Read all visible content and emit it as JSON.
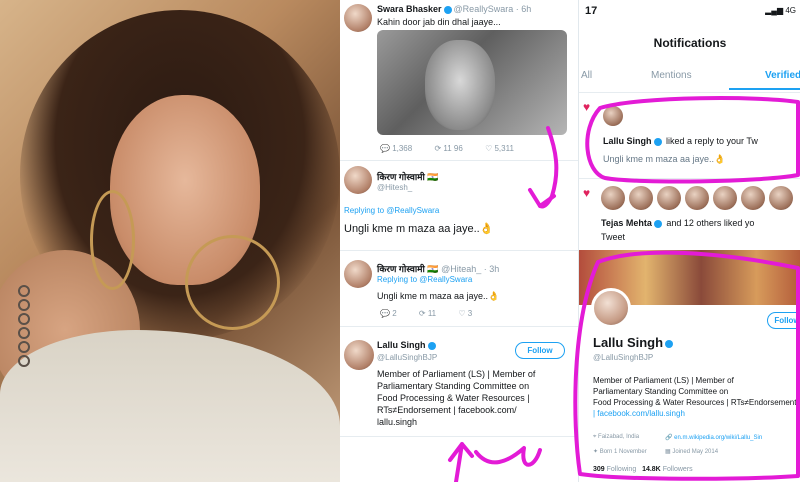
{
  "colors": {
    "annotation": "#e31bd6",
    "twitter_blue": "#1da1f2",
    "heart": "#e0245e"
  },
  "middle": {
    "tweet1": {
      "name": "Swara Bhasker",
      "handle": "@ReallySwara · 6h",
      "text": "Kahin door jab din dhal jaaye...",
      "actions": [
        "1,368",
        "11 96",
        "5,311"
      ]
    },
    "reply1": {
      "name": "किरण गोस्वामी 🇮🇳",
      "handle": "@Hitesh_",
      "replying_to": "Replying to @ReallySwara",
      "text": "Ungli kme m maza aa jaye..👌"
    },
    "reply2": {
      "name": "किरण गोस्वामी 🇮🇳",
      "handle": "@Hiteah_ · 3h",
      "replying_to": "Replying to @ReallySwara",
      "text": "Ungli kme m maza aa jaye..👌",
      "actions": [
        "2",
        "11",
        "3"
      ]
    },
    "profile_card": {
      "name": "Lallu Singh",
      "handle": "@LalluSinghBJP",
      "follow_label": "Follow",
      "bio": [
        "Member of Parliament (LS) | Member of",
        "Parliamentary Standing Committee on",
        "Food Processing & Water Resources |",
        "RTs≠Endorsement | facebook.com/",
        "lallu.singh"
      ]
    }
  },
  "right": {
    "status_time": "17",
    "status_icons": "▂▄▆ 4G",
    "title": "Notifications",
    "tabs": [
      "All",
      "Mentions",
      "Verified"
    ],
    "notif1": {
      "name": "Lallu Singh",
      "action": "liked a reply to your Tw",
      "quote": "Ungli kme m maza aa jaye..👌"
    },
    "notif2": {
      "name": "Tejas Mehta",
      "action": "and 12 others liked yo",
      "tail": "Tweet"
    },
    "profile": {
      "name": "Lallu Singh",
      "handle": "@LalluSinghBJP",
      "follow_label": "Follow",
      "bio": [
        "Member of Parliament (LS) | Member of",
        "Parliamentary Standing Committee on",
        "Food Processing & Water Resources | RTs≠Endorsement",
        "| facebook.com/lallu.singh"
      ],
      "location": "Faizabad, India",
      "website": "en.m.wikipedia.org/wiki/Lallu_Sin",
      "born": "Born 1 November",
      "joined": "Joined May 2014",
      "following_count": "309",
      "following_label": "Following",
      "followers_count": "14.8K",
      "followers_label": "Followers"
    }
  }
}
